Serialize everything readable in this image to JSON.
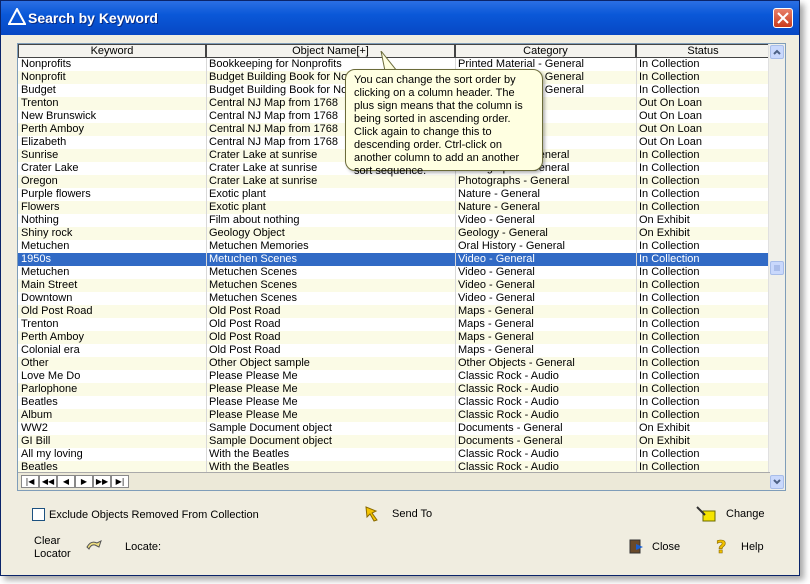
{
  "window": {
    "title": "Search by Keyword"
  },
  "columns": [
    "Keyword",
    "Object Name[+]",
    "Category",
    "Status"
  ],
  "rows": [
    [
      "Nonprofits",
      "Bookkeeping for Nonprofits",
      "Printed Material - General",
      "In Collection"
    ],
    [
      "Nonprofit",
      "Budget Building Book for Nonprofits",
      "Printed Material - General",
      "In Collection"
    ],
    [
      "Budget",
      "Budget Building Book for Nonprofits",
      "Printed Material - General",
      "In Collection"
    ],
    [
      "Trenton",
      "Central NJ Map from 1768",
      "",
      "Out On Loan"
    ],
    [
      "New Brunswick",
      "Central NJ Map from 1768",
      "",
      "Out On Loan"
    ],
    [
      "Perth Amboy",
      "Central NJ Map from 1768",
      "",
      "Out On Loan"
    ],
    [
      "Elizabeth",
      "Central NJ Map from 1768",
      "",
      "Out On Loan"
    ],
    [
      "Sunrise",
      "Crater Lake at sunrise",
      "Photographs - General",
      "In Collection"
    ],
    [
      "Crater Lake",
      "Crater Lake at sunrise",
      "Photographs - General",
      "In Collection"
    ],
    [
      "Oregon",
      "Crater Lake at sunrise",
      "Photographs - General",
      "In Collection"
    ],
    [
      "Purple flowers",
      "Exotic plant",
      "Nature - General",
      "In Collection"
    ],
    [
      "Flowers",
      "Exotic plant",
      "Nature - General",
      "In Collection"
    ],
    [
      "Nothing",
      "Film about nothing",
      "Video - General",
      "On Exhibit"
    ],
    [
      "Shiny rock",
      "Geology Object",
      "Geology - General",
      "On Exhibit"
    ],
    [
      "Metuchen",
      "Metuchen Memories",
      "Oral History - General",
      "In Collection"
    ],
    [
      "1950s",
      "Metuchen Scenes",
      "Video - General",
      "In Collection"
    ],
    [
      "Metuchen",
      "Metuchen Scenes",
      "Video - General",
      "In Collection"
    ],
    [
      "Main Street",
      "Metuchen Scenes",
      "Video - General",
      "In Collection"
    ],
    [
      "Downtown",
      "Metuchen Scenes",
      "Video - General",
      "In Collection"
    ],
    [
      "Old Post Road",
      "Old Post Road",
      "Maps - General",
      "In Collection"
    ],
    [
      "Trenton",
      "Old Post Road",
      "Maps - General",
      "In Collection"
    ],
    [
      "Perth Amboy",
      "Old Post Road",
      "Maps - General",
      "In Collection"
    ],
    [
      "Colonial era",
      "Old Post Road",
      "Maps - General",
      "In Collection"
    ],
    [
      "Other",
      "Other Object sample",
      "Other Objects - General",
      "In Collection"
    ],
    [
      "Love Me Do",
      "Please Please Me",
      "Classic Rock - Audio",
      "In Collection"
    ],
    [
      "Parlophone",
      "Please Please Me",
      "Classic Rock - Audio",
      "In Collection"
    ],
    [
      "Beatles",
      "Please Please Me",
      "Classic Rock - Audio",
      "In Collection"
    ],
    [
      "Album",
      "Please Please Me",
      "Classic Rock - Audio",
      "In Collection"
    ],
    [
      "WW2",
      "Sample Document object",
      "Documents - General",
      "On Exhibit"
    ],
    [
      "GI Bill",
      "Sample Document object",
      "Documents - General",
      "On Exhibit"
    ],
    [
      "All my loving",
      "With the Beatles",
      "Classic Rock - Audio",
      "In Collection"
    ],
    [
      "Beatles",
      "With the Beatles",
      "Classic Rock - Audio",
      "In Collection"
    ]
  ],
  "selected_row": 15,
  "tooltip": "You can change the sort order by clicking on a column header. The plus sign means that the column is being sorted in ascending order. Click again to change this to descending order. Ctrl-click on another column to add an another sort sequence.",
  "nav": [
    "|◀",
    "◀◀",
    "◀",
    "▶",
    "▶▶",
    "▶|"
  ],
  "footer": {
    "exclude_label": "Exclude Objects Removed From Collection",
    "send_to": "Send To",
    "change": "Change",
    "clear_locator_1": "Clear",
    "clear_locator_2": "Locator",
    "locate": "Locate:",
    "close": "Close",
    "help": "Help"
  },
  "colors": {
    "titlebar": "#0a58d8",
    "selected": "#316ac5",
    "tooltip": "#ffffe1"
  }
}
